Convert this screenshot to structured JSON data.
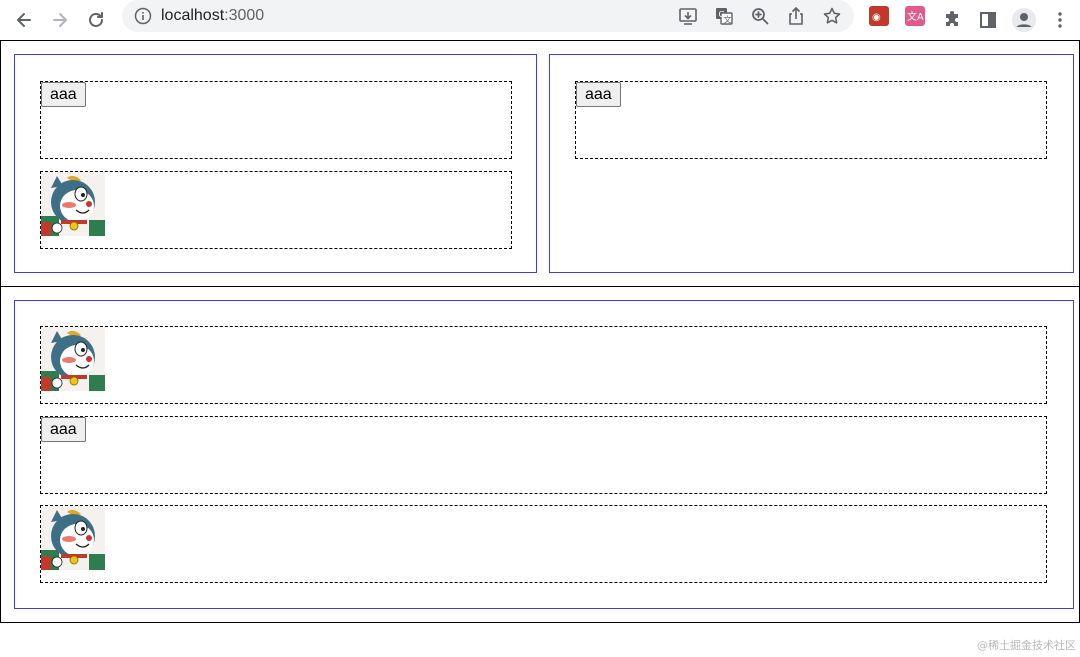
{
  "browser": {
    "url_host": "localhost",
    "url_port": ":3000",
    "icons": {
      "back": "arrow-left-icon",
      "forward": "arrow-right-icon",
      "reload": "reload-icon",
      "site_info": "info-icon",
      "install": "install-icon",
      "translate": "translate-icon",
      "zoom": "zoom-in-icon",
      "share": "share-icon",
      "bookmark": "star-icon",
      "extensions": "puzzle-icon",
      "side_panel": "side-panel-icon",
      "profile": "avatar-icon",
      "menu": "kebab-menu-icon"
    },
    "ext_colors": [
      "#c0392b",
      "#e05a8a"
    ]
  },
  "content": {
    "row1": {
      "left_panel": {
        "button_label": "aaa",
        "image_icon": "cartoon-cat-image"
      },
      "right_panel": {
        "button_label": "aaa"
      }
    },
    "row2": {
      "panel": {
        "top_image_icon": "cartoon-cat-image",
        "button_label": "aaa",
        "bottom_image_icon": "cartoon-cat-image"
      }
    }
  },
  "watermark": "@稀土掘金技术社区",
  "colors": {
    "panel_border": "#3b3bff",
    "row_border": "#000000",
    "button_bg": "#efefef"
  }
}
